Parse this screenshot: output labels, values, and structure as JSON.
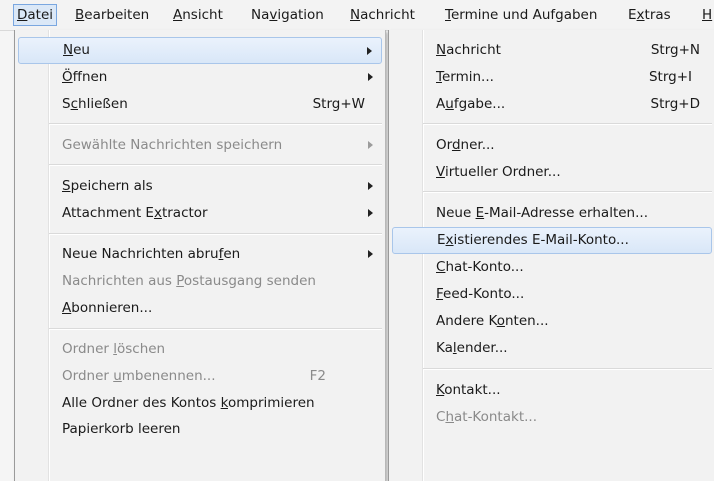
{
  "menubar": {
    "items": [
      {
        "pre": "",
        "u": "D",
        "post": "atei"
      },
      {
        "pre": "",
        "u": "B",
        "post": "earbeiten"
      },
      {
        "pre": "",
        "u": "A",
        "post": "nsicht"
      },
      {
        "pre": "Na",
        "u": "v",
        "post": "igation"
      },
      {
        "pre": "",
        "u": "N",
        "post": "achricht"
      },
      {
        "pre": "",
        "u": "T",
        "post": "ermine und Aufgaben"
      },
      {
        "pre": "E",
        "u": "x",
        "post": "tras"
      },
      {
        "pre": "",
        "u": "H",
        "post": ""
      }
    ]
  },
  "file_menu": {
    "items": [
      {
        "pre": "",
        "u": "N",
        "post": "eu",
        "shortcut": "",
        "submenu": true,
        "enabled": true,
        "highlighted": true
      },
      {
        "pre": "",
        "u": "Ö",
        "post": "ffnen",
        "shortcut": "",
        "submenu": true,
        "enabled": true
      },
      {
        "pre": "S",
        "u": "c",
        "post": "hließen",
        "shortcut": "Strg+W",
        "submenu": false,
        "enabled": true
      },
      {
        "pre": "Gewählte Nachrichten speichern",
        "u": "",
        "post": "",
        "shortcut": "",
        "submenu": true,
        "enabled": false
      },
      {
        "pre": "",
        "u": "S",
        "post": "peichern als",
        "shortcut": "",
        "submenu": true,
        "enabled": true
      },
      {
        "pre": "Attachment E",
        "u": "x",
        "post": "tractor",
        "shortcut": "",
        "submenu": true,
        "enabled": true
      },
      {
        "pre": "Neue Nachrichten abru",
        "u": "f",
        "post": "en",
        "shortcut": "",
        "submenu": true,
        "enabled": true
      },
      {
        "pre": "Nachrichten aus ",
        "u": "P",
        "post": "ostausgang senden",
        "shortcut": "",
        "submenu": false,
        "enabled": false
      },
      {
        "pre": "",
        "u": "A",
        "post": "bonnieren...",
        "shortcut": "",
        "submenu": false,
        "enabled": true
      },
      {
        "pre": "Ordner ",
        "u": "l",
        "post": "öschen",
        "shortcut": "",
        "submenu": false,
        "enabled": false
      },
      {
        "pre": "Ordner ",
        "u": "u",
        "post": "mbenennen...",
        "shortcut": "F2",
        "submenu": false,
        "enabled": false
      },
      {
        "pre": "Alle Ordner des Kontos ",
        "u": "k",
        "post": "omprimieren",
        "shortcut": "",
        "submenu": false,
        "enabled": true
      },
      {
        "pre": "Papierkorb leeren",
        "u": "",
        "post": "",
        "shortcut": "",
        "submenu": false,
        "enabled": true
      }
    ]
  },
  "new_submenu": {
    "items": [
      {
        "pre": "",
        "u": "N",
        "post": "achricht",
        "shortcut": "Strg+N",
        "enabled": true
      },
      {
        "pre": "",
        "u": "T",
        "post": "ermin...",
        "shortcut": "Strg+I",
        "enabled": true
      },
      {
        "pre": "A",
        "u": "u",
        "post": "fgabe...",
        "shortcut": "Strg+D",
        "enabled": true
      },
      {
        "pre": "Or",
        "u": "d",
        "post": "ner...",
        "shortcut": "",
        "enabled": true
      },
      {
        "pre": "",
        "u": "V",
        "post": "irtueller Ordner...",
        "shortcut": "",
        "enabled": true
      },
      {
        "pre": "Neue ",
        "u": "E",
        "post": "-Mail-Adresse erhalten...",
        "shortcut": "",
        "enabled": true
      },
      {
        "pre": "E",
        "u": "x",
        "post": "istierendes E-Mail-Konto...",
        "shortcut": "",
        "enabled": true,
        "highlighted": true
      },
      {
        "pre": "",
        "u": "C",
        "post": "hat-Konto...",
        "shortcut": "",
        "enabled": true
      },
      {
        "pre": "",
        "u": "F",
        "post": "eed-Konto...",
        "shortcut": "",
        "enabled": true
      },
      {
        "pre": "Andere K",
        "u": "o",
        "post": "nten...",
        "shortcut": "",
        "enabled": true
      },
      {
        "pre": "Ka",
        "u": "l",
        "post": "ender...",
        "shortcut": "",
        "enabled": true
      },
      {
        "pre": "",
        "u": "K",
        "post": "ontakt...",
        "shortcut": "",
        "enabled": true
      },
      {
        "pre": "C",
        "u": "h",
        "post": "at-Kontakt...",
        "shortcut": "",
        "enabled": false
      }
    ]
  }
}
